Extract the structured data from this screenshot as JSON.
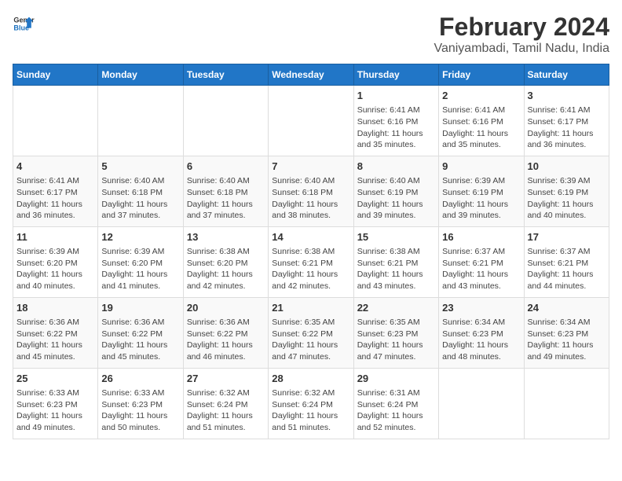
{
  "header": {
    "logo_line1": "General",
    "logo_line2": "Blue",
    "title": "February 2024",
    "subtitle": "Vaniyambadi, Tamil Nadu, India"
  },
  "days_of_week": [
    "Sunday",
    "Monday",
    "Tuesday",
    "Wednesday",
    "Thursday",
    "Friday",
    "Saturday"
  ],
  "weeks": [
    [
      {
        "day": "",
        "detail": ""
      },
      {
        "day": "",
        "detail": ""
      },
      {
        "day": "",
        "detail": ""
      },
      {
        "day": "",
        "detail": ""
      },
      {
        "day": "1",
        "detail": "Sunrise: 6:41 AM\nSunset: 6:16 PM\nDaylight: 11 hours and 35 minutes."
      },
      {
        "day": "2",
        "detail": "Sunrise: 6:41 AM\nSunset: 6:16 PM\nDaylight: 11 hours and 35 minutes."
      },
      {
        "day": "3",
        "detail": "Sunrise: 6:41 AM\nSunset: 6:17 PM\nDaylight: 11 hours and 36 minutes."
      }
    ],
    [
      {
        "day": "4",
        "detail": "Sunrise: 6:41 AM\nSunset: 6:17 PM\nDaylight: 11 hours and 36 minutes."
      },
      {
        "day": "5",
        "detail": "Sunrise: 6:40 AM\nSunset: 6:18 PM\nDaylight: 11 hours and 37 minutes."
      },
      {
        "day": "6",
        "detail": "Sunrise: 6:40 AM\nSunset: 6:18 PM\nDaylight: 11 hours and 37 minutes."
      },
      {
        "day": "7",
        "detail": "Sunrise: 6:40 AM\nSunset: 6:18 PM\nDaylight: 11 hours and 38 minutes."
      },
      {
        "day": "8",
        "detail": "Sunrise: 6:40 AM\nSunset: 6:19 PM\nDaylight: 11 hours and 39 minutes."
      },
      {
        "day": "9",
        "detail": "Sunrise: 6:39 AM\nSunset: 6:19 PM\nDaylight: 11 hours and 39 minutes."
      },
      {
        "day": "10",
        "detail": "Sunrise: 6:39 AM\nSunset: 6:19 PM\nDaylight: 11 hours and 40 minutes."
      }
    ],
    [
      {
        "day": "11",
        "detail": "Sunrise: 6:39 AM\nSunset: 6:20 PM\nDaylight: 11 hours and 40 minutes."
      },
      {
        "day": "12",
        "detail": "Sunrise: 6:39 AM\nSunset: 6:20 PM\nDaylight: 11 hours and 41 minutes."
      },
      {
        "day": "13",
        "detail": "Sunrise: 6:38 AM\nSunset: 6:20 PM\nDaylight: 11 hours and 42 minutes."
      },
      {
        "day": "14",
        "detail": "Sunrise: 6:38 AM\nSunset: 6:21 PM\nDaylight: 11 hours and 42 minutes."
      },
      {
        "day": "15",
        "detail": "Sunrise: 6:38 AM\nSunset: 6:21 PM\nDaylight: 11 hours and 43 minutes."
      },
      {
        "day": "16",
        "detail": "Sunrise: 6:37 AM\nSunset: 6:21 PM\nDaylight: 11 hours and 43 minutes."
      },
      {
        "day": "17",
        "detail": "Sunrise: 6:37 AM\nSunset: 6:21 PM\nDaylight: 11 hours and 44 minutes."
      }
    ],
    [
      {
        "day": "18",
        "detail": "Sunrise: 6:36 AM\nSunset: 6:22 PM\nDaylight: 11 hours and 45 minutes."
      },
      {
        "day": "19",
        "detail": "Sunrise: 6:36 AM\nSunset: 6:22 PM\nDaylight: 11 hours and 45 minutes."
      },
      {
        "day": "20",
        "detail": "Sunrise: 6:36 AM\nSunset: 6:22 PM\nDaylight: 11 hours and 46 minutes."
      },
      {
        "day": "21",
        "detail": "Sunrise: 6:35 AM\nSunset: 6:22 PM\nDaylight: 11 hours and 47 minutes."
      },
      {
        "day": "22",
        "detail": "Sunrise: 6:35 AM\nSunset: 6:23 PM\nDaylight: 11 hours and 47 minutes."
      },
      {
        "day": "23",
        "detail": "Sunrise: 6:34 AM\nSunset: 6:23 PM\nDaylight: 11 hours and 48 minutes."
      },
      {
        "day": "24",
        "detail": "Sunrise: 6:34 AM\nSunset: 6:23 PM\nDaylight: 11 hours and 49 minutes."
      }
    ],
    [
      {
        "day": "25",
        "detail": "Sunrise: 6:33 AM\nSunset: 6:23 PM\nDaylight: 11 hours and 49 minutes."
      },
      {
        "day": "26",
        "detail": "Sunrise: 6:33 AM\nSunset: 6:23 PM\nDaylight: 11 hours and 50 minutes."
      },
      {
        "day": "27",
        "detail": "Sunrise: 6:32 AM\nSunset: 6:24 PM\nDaylight: 11 hours and 51 minutes."
      },
      {
        "day": "28",
        "detail": "Sunrise: 6:32 AM\nSunset: 6:24 PM\nDaylight: 11 hours and 51 minutes."
      },
      {
        "day": "29",
        "detail": "Sunrise: 6:31 AM\nSunset: 6:24 PM\nDaylight: 11 hours and 52 minutes."
      },
      {
        "day": "",
        "detail": ""
      },
      {
        "day": "",
        "detail": ""
      }
    ]
  ]
}
